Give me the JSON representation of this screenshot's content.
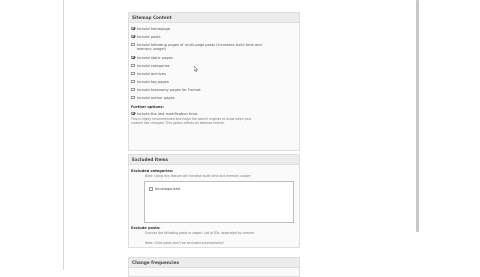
{
  "sitemap_content": {
    "title": "Sitemap Content",
    "items": [
      {
        "label": "Include homepage",
        "checked": true
      },
      {
        "label": "Include posts",
        "checked": true
      },
      {
        "label": "Include following pages of multi-page posts (Increases build time and",
        "checked": false
      },
      {
        "label": "memory usage!)",
        "checked": false
      },
      {
        "label": "Include static pages",
        "checked": true
      },
      {
        "label": "Include categories",
        "checked": false
      },
      {
        "label": "Include archives",
        "checked": false
      },
      {
        "label": "Include tag pages",
        "checked": false
      },
      {
        "label": "Include taxonomy pages for Format",
        "checked": false
      },
      {
        "label": "Include author pages",
        "checked": false
      }
    ],
    "further_options_heading": "Further options:",
    "lastmod": {
      "label": "Include the last modification time.",
      "checked": true
    },
    "lastmod_note_1": "This is highly recommended and helps the search engines to know when your",
    "lastmod_note_2": "content has changed. This option affects all sitemap entries."
  },
  "excluded_items": {
    "title": "Excluded Items",
    "categories_heading": "Excluded categories:",
    "categories_note": "Note: Using this feature will increase build time and memory usage!",
    "categories": [
      {
        "label": "Uncategorized",
        "checked": false
      }
    ],
    "posts_heading": "Exclude posts:",
    "posts_note": "Exclude the following posts or pages: List of IDs, separated by comma",
    "posts_note_2": "Note: Child posts won't be excluded automatically!"
  },
  "change_frequencies": {
    "title": "Change frequencies"
  }
}
